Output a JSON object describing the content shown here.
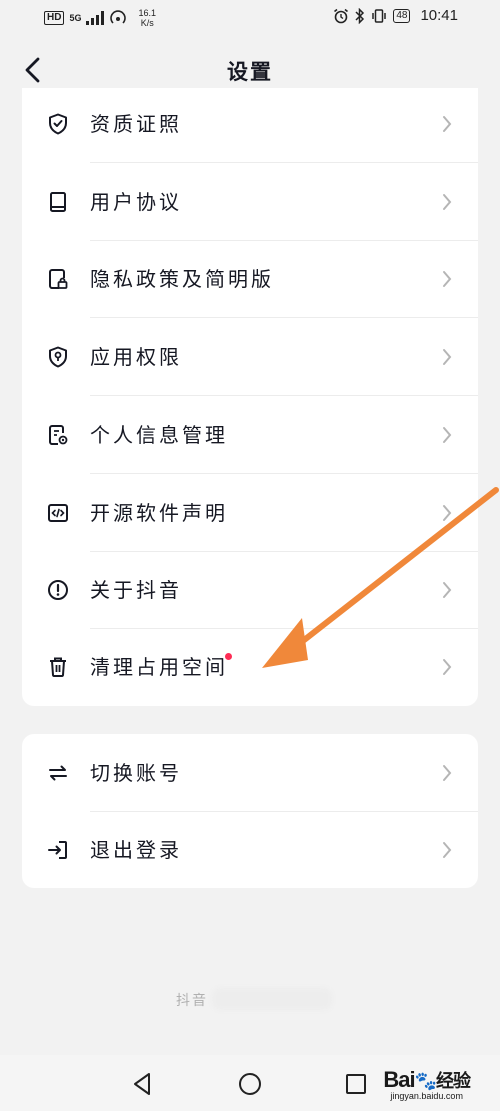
{
  "status_bar": {
    "hd_label": "HD",
    "network_label": "5G",
    "speed_value": "16.1",
    "speed_unit": "K/s",
    "battery": "48",
    "time": "10:41"
  },
  "header": {
    "title": "设置"
  },
  "settings_card": {
    "items": [
      {
        "label": "资质证照",
        "icon": "shield-check-icon"
      },
      {
        "label": "用户协议",
        "icon": "book-icon"
      },
      {
        "label": "隐私政策及简明版",
        "icon": "privacy-doc-icon"
      },
      {
        "label": "应用权限",
        "icon": "permission-shield-icon"
      },
      {
        "label": "个人信息管理",
        "icon": "personal-info-icon"
      },
      {
        "label": "开源软件声明",
        "icon": "code-icon"
      },
      {
        "label": "关于抖音",
        "icon": "info-icon"
      },
      {
        "label": "清理占用空间",
        "icon": "trash-icon",
        "badge": "red-dot"
      }
    ]
  },
  "account_card": {
    "items": [
      {
        "label": "切换账号",
        "icon": "switch-icon"
      },
      {
        "label": "退出登录",
        "icon": "logout-icon"
      }
    ]
  },
  "footer": {
    "brand": "抖音"
  },
  "watermark": {
    "brand": "Bai",
    "brand_cn": "经验",
    "url": "jingyan.baidu.com"
  },
  "colors": {
    "background": "#f2f2f2",
    "card": "#ffffff",
    "badge": "#fe2c55",
    "annotation_arrow": "#f0883a"
  }
}
